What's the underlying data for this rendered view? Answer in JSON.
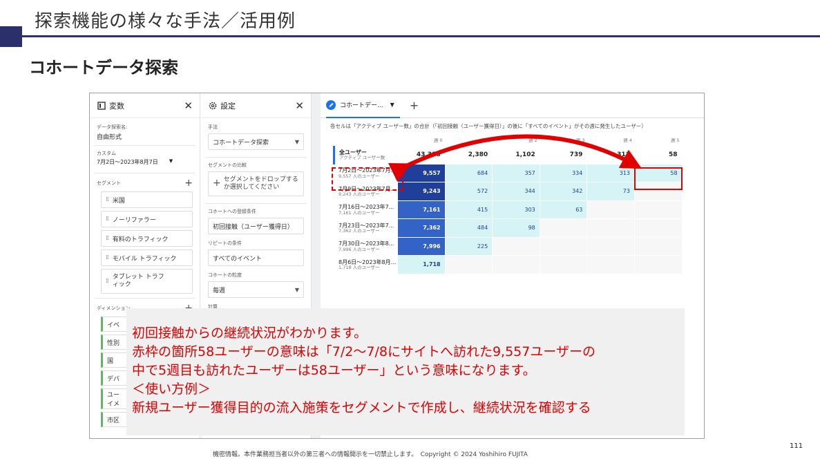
{
  "slide": {
    "title": "探索機能の様々な手法／活用例",
    "subtitle": "コホートデータ探索",
    "footer": "機密情報。本件業務担当者以外の第三者への情報開示を一切禁止します。　Copyright © 2024 Yoshihiro FUJITA",
    "page_number": "111"
  },
  "variables_panel": {
    "title": "変数",
    "exploration_name_label": "データ探索名:",
    "exploration_name": "自由形式",
    "date_label": "カスタム",
    "date_range": "7月2日～2023年8月7日",
    "segments_label": "セグメント",
    "segments": [
      "米国",
      "ノーリファラー",
      "有料のトラフィック",
      "モバイル トラフィック",
      "タブレット トラフィック"
    ],
    "dimensions_label": "ディメンション",
    "dimensions": [
      "イベ",
      "性別",
      "国",
      "デバ",
      "ユーイメ",
      "市区"
    ]
  },
  "settings_panel": {
    "title": "設定",
    "technique_label": "手法",
    "technique": "コホートデータ探索",
    "segment_compare_label": "セグメントの比較",
    "segment_drop_text": "セグメントをドロップするか選択してください",
    "inclusion_label": "コホートへの登録条件",
    "inclusion": "初回接触（ユーザー獲得日）",
    "return_label": "リピートの条件",
    "return": "すべてのイベント",
    "granularity_label": "コホートの粒度",
    "granularity": "毎週",
    "calc_label": "計算"
  },
  "main": {
    "tab_label": "コホートデー...",
    "note": "各セルは「アクティブ ユーザー数」の合計（「初回接触（ユーザー獲得日）」の後に「すべてのイベント」がその週に発生したユーザー）",
    "weeks": [
      "週 0",
      "週 1",
      "週 2",
      "週 3",
      "週 4",
      "週 5"
    ],
    "total": {
      "label": "全ユーザー",
      "sub": "アクティブ ユーザー数",
      "values": [
        "43,318",
        "2,380",
        "1,102",
        "739",
        "313",
        "58"
      ]
    },
    "rows": [
      {
        "label": "7月2日～2023年7月...",
        "sub": "9,557 人のユーザー",
        "values": [
          "9,557",
          "684",
          "357",
          "334",
          "313",
          "58"
        ]
      },
      {
        "label": "7月9日～2023年7月...",
        "sub": "9,243 人のユーザー",
        "values": [
          "9,243",
          "572",
          "344",
          "342",
          "73",
          ""
        ]
      },
      {
        "label": "7月16日～2023年7...",
        "sub": "7,161 人のユーザー",
        "values": [
          "7,161",
          "415",
          "303",
          "63",
          "",
          ""
        ]
      },
      {
        "label": "7月23日～2023年7...",
        "sub": "7,362 人のユーザー",
        "values": [
          "7,362",
          "484",
          "98",
          "",
          "",
          ""
        ]
      },
      {
        "label": "7月30日～2023年8...",
        "sub": "7,996 人のユーザー",
        "values": [
          "7,996",
          "225",
          "",
          "",
          "",
          ""
        ]
      },
      {
        "label": "8月6日～2023年8月...",
        "sub": "1,718 人のユーザー",
        "values": [
          "1,718",
          "",
          "",
          "",
          "",
          ""
        ]
      }
    ],
    "colors": {
      "dark": "#1f3f9b",
      "mid": "#3363c7",
      "light": "#d6f3f6",
      "empty": "#f7f7f7"
    }
  },
  "callout": {
    "lines": [
      "初回接触からの継続状況がわかります。",
      "赤枠の箇所58ユーザーの意味は「7/2～7/8にサイトへ訪れた9,557ユーザーの",
      "中で5週目も訪れたユーザーは58ユーザー」という意味になります。",
      "＜使い方例＞",
      "新規ユーザー獲得目的の流入施策をセグメントで作成し、継続状況を確認する"
    ]
  }
}
